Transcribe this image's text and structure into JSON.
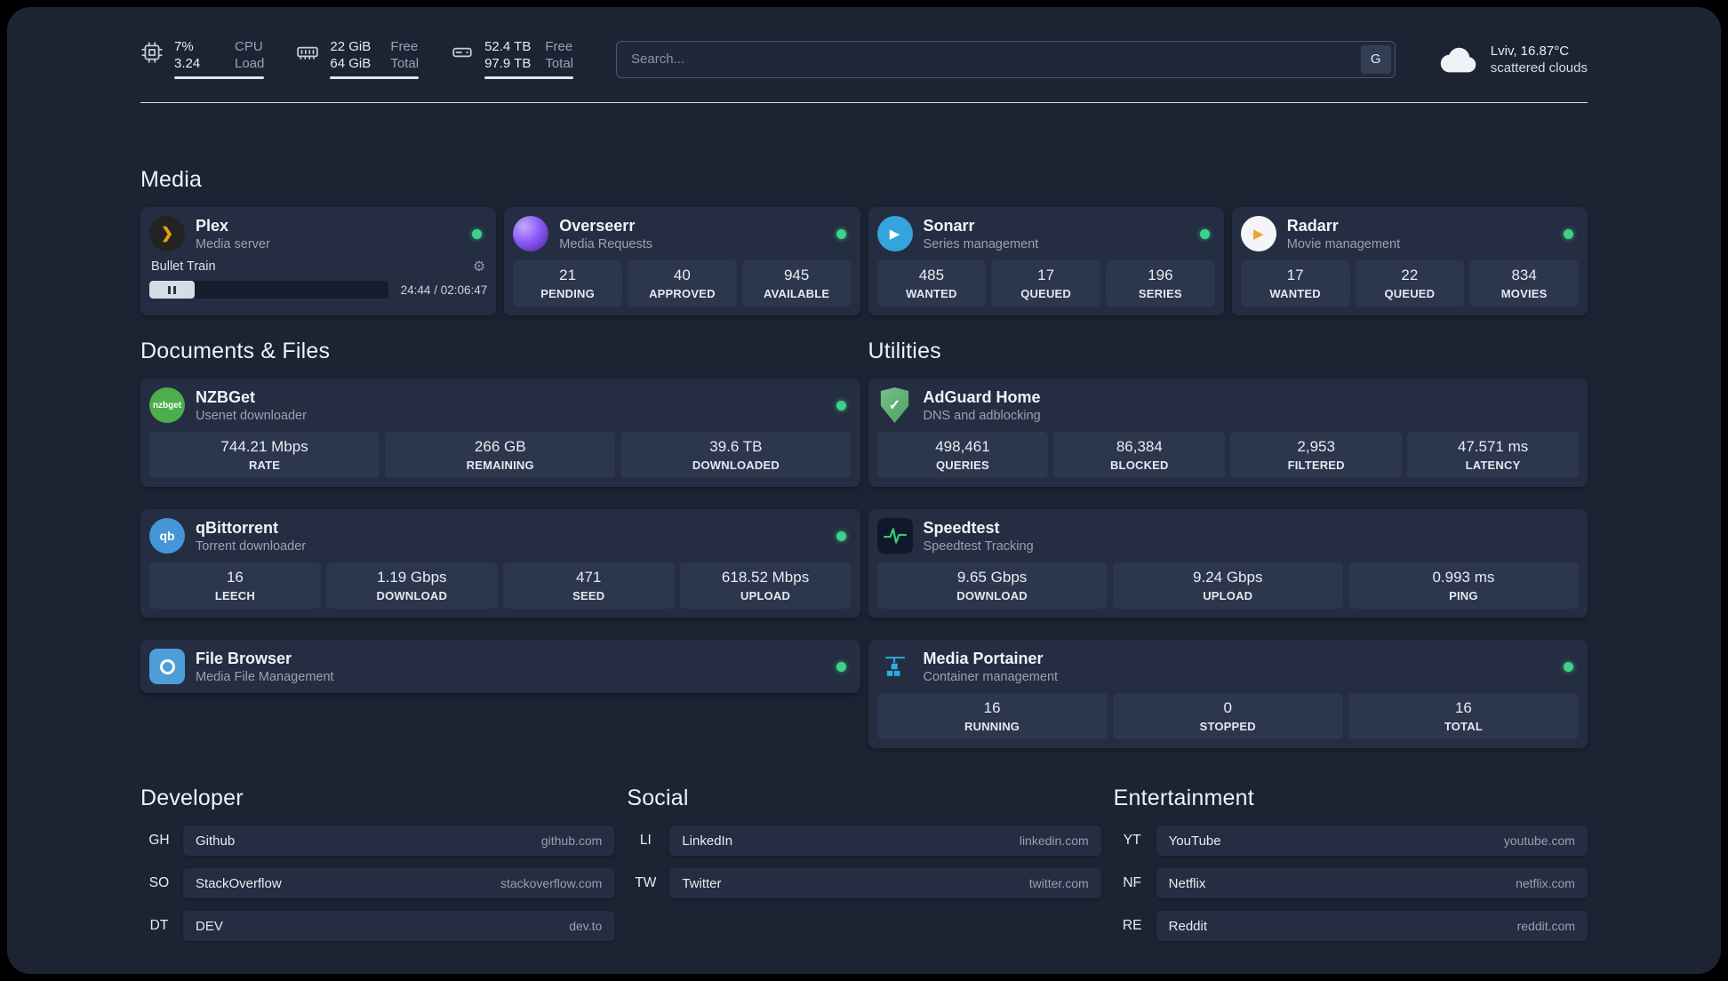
{
  "colors": {
    "status_online": "#3fd08c",
    "background": "#1c2434",
    "card": "#242d41",
    "stat_box": "#2c364d"
  },
  "icons": {
    "gear": "⚙",
    "plex_chevron": "❯",
    "play": "▶",
    "check": "✓"
  },
  "topbar": {
    "cpu": {
      "value_top": "7%",
      "label_top": "CPU",
      "value_bottom": "3.24",
      "label_bottom": "Load"
    },
    "memory": {
      "value_top": "22 GiB",
      "label_top": "Free",
      "value_bottom": "64 GiB",
      "label_bottom": "Total"
    },
    "disk": {
      "value_top": "52.4 TB",
      "label_top": "Free",
      "value_bottom": "97.9 TB",
      "label_bottom": "Total"
    },
    "search": {
      "placeholder": "Search...",
      "provider_button": "G"
    },
    "weather": {
      "location": "Lviv, 16.87°C",
      "condition": "scattered clouds"
    }
  },
  "sections": {
    "media": {
      "title": "Media",
      "plex": {
        "name": "Plex",
        "description": "Media server",
        "now_playing": "Bullet Train",
        "time": "24:44 / 02:06:47"
      },
      "overseerr": {
        "name": "Overseerr",
        "description": "Media Requests",
        "stats": [
          {
            "value": "21",
            "label": "PENDING"
          },
          {
            "value": "40",
            "label": "APPROVED"
          },
          {
            "value": "945",
            "label": "AVAILABLE"
          }
        ]
      },
      "sonarr": {
        "name": "Sonarr",
        "description": "Series management",
        "stats": [
          {
            "value": "485",
            "label": "WANTED"
          },
          {
            "value": "17",
            "label": "QUEUED"
          },
          {
            "value": "196",
            "label": "SERIES"
          }
        ]
      },
      "radarr": {
        "name": "Radarr",
        "description": "Movie management",
        "stats": [
          {
            "value": "17",
            "label": "WANTED"
          },
          {
            "value": "22",
            "label": "QUEUED"
          },
          {
            "value": "834",
            "label": "MOVIES"
          }
        ]
      }
    },
    "documents": {
      "title": "Documents & Files",
      "nzbget": {
        "name": "NZBGet",
        "description": "Usenet downloader",
        "icon_text": "nzbget",
        "stats": [
          {
            "value": "744.21 Mbps",
            "label": "RATE"
          },
          {
            "value": "266 GB",
            "label": "REMAINING"
          },
          {
            "value": "39.6 TB",
            "label": "DOWNLOADED"
          }
        ]
      },
      "qbittorrent": {
        "name": "qBittorrent",
        "description": "Torrent downloader",
        "icon_text": "qb",
        "stats": [
          {
            "value": "16",
            "label": "LEECH"
          },
          {
            "value": "1.19 Gbps",
            "label": "DOWNLOAD"
          },
          {
            "value": "471",
            "label": "SEED"
          },
          {
            "value": "618.52 Mbps",
            "label": "UPLOAD"
          }
        ]
      },
      "filebrowser": {
        "name": "File Browser",
        "description": "Media File Management"
      }
    },
    "utilities": {
      "title": "Utilities",
      "adguard": {
        "name": "AdGuard Home",
        "description": "DNS and adblocking",
        "stats": [
          {
            "value": "498,461",
            "label": "QUERIES"
          },
          {
            "value": "86,384",
            "label": "BLOCKED"
          },
          {
            "value": "2,953",
            "label": "FILTERED"
          },
          {
            "value": "47.571 ms",
            "label": "LATENCY"
          }
        ]
      },
      "speedtest": {
        "name": "Speedtest",
        "description": "Speedtest Tracking",
        "stats": [
          {
            "value": "9.65 Gbps",
            "label": "DOWNLOAD"
          },
          {
            "value": "9.24 Gbps",
            "label": "UPLOAD"
          },
          {
            "value": "0.993 ms",
            "label": "PING"
          }
        ]
      },
      "portainer": {
        "name": "Media Portainer",
        "description": "Container management",
        "stats": [
          {
            "value": "16",
            "label": "RUNNING"
          },
          {
            "value": "0",
            "label": "STOPPED"
          },
          {
            "value": "16",
            "label": "TOTAL"
          }
        ]
      }
    }
  },
  "bookmarks": [
    {
      "title": "Developer",
      "items": [
        {
          "abbr": "GH",
          "name": "Github",
          "url": "github.com"
        },
        {
          "abbr": "SO",
          "name": "StackOverflow",
          "url": "stackoverflow.com"
        },
        {
          "abbr": "DT",
          "name": "DEV",
          "url": "dev.to"
        }
      ]
    },
    {
      "title": "Social",
      "items": [
        {
          "abbr": "LI",
          "name": "LinkedIn",
          "url": "linkedin.com"
        },
        {
          "abbr": "TW",
          "name": "Twitter",
          "url": "twitter.com"
        }
      ]
    },
    {
      "title": "Entertainment",
      "items": [
        {
          "abbr": "YT",
          "name": "YouTube",
          "url": "youtube.com"
        },
        {
          "abbr": "NF",
          "name": "Netflix",
          "url": "netflix.com"
        },
        {
          "abbr": "RE",
          "name": "Reddit",
          "url": "reddit.com"
        }
      ]
    }
  ]
}
